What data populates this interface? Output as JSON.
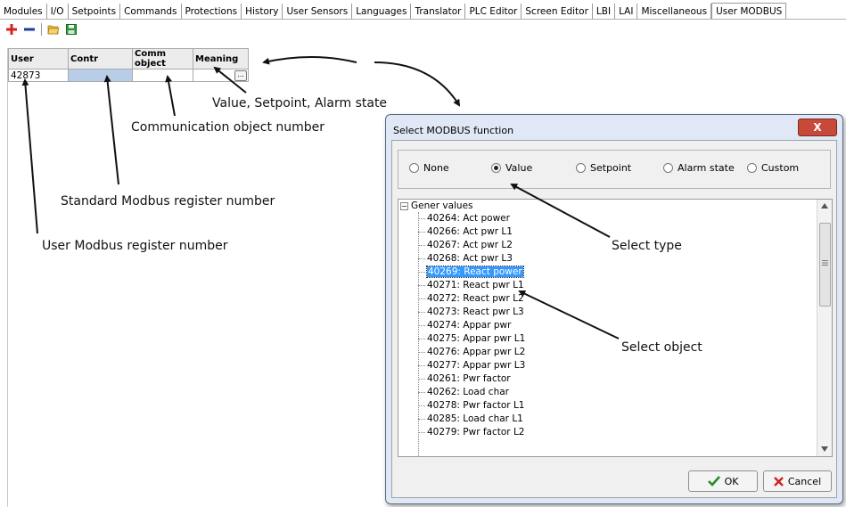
{
  "tabs": [
    "Modules",
    "I/O",
    "Setpoints",
    "Commands",
    "Protections",
    "History",
    "User Sensors",
    "Languages",
    "Translator",
    "PLC Editor",
    "Screen Editor",
    "LBI",
    "LAI",
    "Miscellaneous",
    "User MODBUS"
  ],
  "active_tab": "User MODBUS",
  "toolbar": {
    "icons": [
      "add-icon",
      "remove-icon",
      "open-folder-icon",
      "save-icon"
    ]
  },
  "grid": {
    "headers": [
      "User",
      "Contr",
      "Comm object",
      "Meaning"
    ],
    "row": {
      "user": "42873",
      "contr": "",
      "comm_object": "",
      "meaning": "",
      "ellipsis": "..."
    }
  },
  "annotations": {
    "value_setpoint_alarm": "Value, Setpoint, Alarm state",
    "communication_object": "Communication object number",
    "standard_modbus": "Standard Modbus register number",
    "user_modbus": "User Modbus register number",
    "select_type": "Select type",
    "select_object": "Select object"
  },
  "dialog": {
    "title": "Select MODBUS function",
    "close": "X",
    "radios": [
      "None",
      "Value",
      "Setpoint",
      "Alarm state",
      "Custom"
    ],
    "selected_radio": "Value",
    "tree_root": "Gener values",
    "items": [
      "40264: Act power",
      "40266: Act pwr L1",
      "40267: Act pwr L2",
      "40268: Act pwr L3",
      "40269: React power",
      "40271: React pwr L1",
      "40272: React pwr L2",
      "40273: React pwr L3",
      "40274: Appar pwr",
      "40275: Appar pwr L1",
      "40276: Appar pwr L2",
      "40277: Appar pwr L3",
      "40261: Pwr factor",
      "40262: Load char",
      "40278: Pwr factor L1",
      "40285: Load char L1",
      "40279: Pwr factor L2"
    ],
    "selected_item": "40269: React power",
    "ok": "OK",
    "cancel": "Cancel"
  },
  "colors": {
    "selection": "#3399ff",
    "contr_cell": "#b8cde8",
    "add": "#d32222",
    "ok_check": "#2a8a2a",
    "cancel_x": "#cc2222"
  }
}
